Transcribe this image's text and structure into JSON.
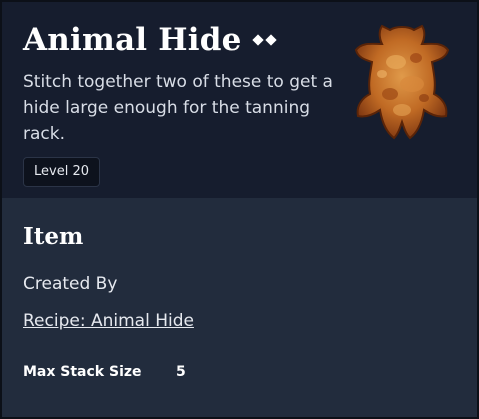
{
  "item": {
    "name": "Animal Hide",
    "rarity_pips": 2,
    "description": "Stitch together two of these to get a hide large enough for the tanning rack.",
    "level_label": "Level 20",
    "image_icon": "animal-hide-icon"
  },
  "details": {
    "section_title": "Item",
    "created_by_label": "Created By",
    "recipe_link": "Recipe: Animal Hide",
    "stats": [
      {
        "label": "Max Stack Size",
        "value": "5"
      }
    ]
  },
  "colors": {
    "header_bg": "#161d2e",
    "body_bg": "#222c3d",
    "hide_brown": "#b05a1c",
    "hide_light": "#d98b3a"
  }
}
